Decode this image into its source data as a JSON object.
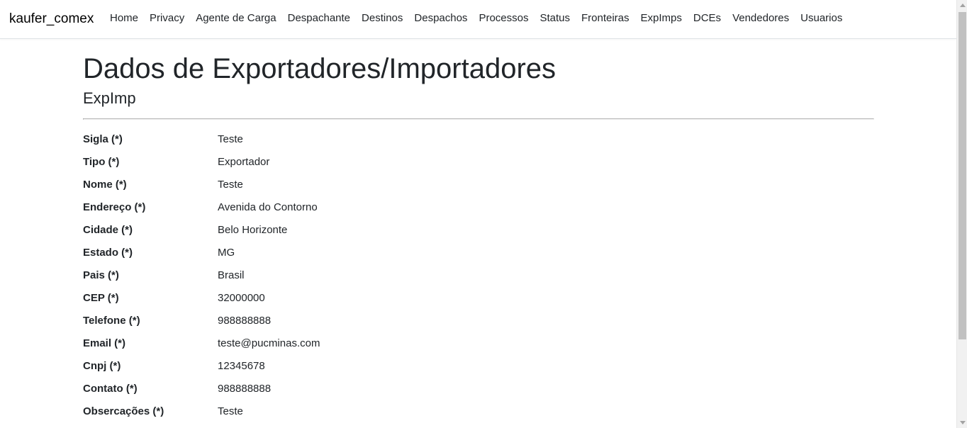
{
  "navbar": {
    "brand": "kaufer_comex",
    "items": [
      {
        "label": "Home"
      },
      {
        "label": "Privacy"
      },
      {
        "label": "Agente de Carga"
      },
      {
        "label": "Despachante"
      },
      {
        "label": "Destinos"
      },
      {
        "label": "Despachos"
      },
      {
        "label": "Processos"
      },
      {
        "label": "Status"
      },
      {
        "label": "Fronteiras"
      },
      {
        "label": "ExpImps"
      },
      {
        "label": "DCEs"
      },
      {
        "label": "Vendedores"
      },
      {
        "label": "Usuarios"
      }
    ]
  },
  "page": {
    "title": "Dados de Exportadores/Importadores",
    "subtitle": "ExpImp"
  },
  "details": [
    {
      "label": "Sigla (*)",
      "value": "Teste"
    },
    {
      "label": "Tipo (*)",
      "value": "Exportador"
    },
    {
      "label": "Nome (*)",
      "value": "Teste"
    },
    {
      "label": "Endereço (*)",
      "value": "Avenida do Contorno"
    },
    {
      "label": "Cidade (*)",
      "value": "Belo Horizonte"
    },
    {
      "label": "Estado (*)",
      "value": "MG"
    },
    {
      "label": "Pais (*)",
      "value": "Brasil"
    },
    {
      "label": "CEP (*)",
      "value": "32000000"
    },
    {
      "label": "Telefone (*)",
      "value": "988888888"
    },
    {
      "label": "Email (*)",
      "value": "teste@pucminas.com"
    },
    {
      "label": "Cnpj (*)",
      "value": "12345678"
    },
    {
      "label": "Contato (*)",
      "value": "988888888"
    },
    {
      "label": "Obsercações (*)",
      "value": "Teste"
    }
  ],
  "colors": {
    "text": "#212529",
    "border": "#dee2e6",
    "background": "#ffffff"
  }
}
